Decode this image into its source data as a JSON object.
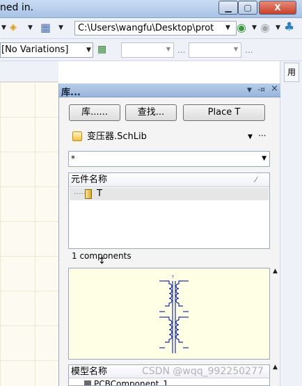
{
  "window": {
    "title_fragment": "ned in.",
    "buttons": {
      "minimize": "▁",
      "maximize": "▢",
      "close": "X"
    }
  },
  "toolbar": {
    "path": "C:\\Users\\wangfu\\Desktop\\prot",
    "variation": "[No Variations]",
    "dots": "..."
  },
  "side_panel_tab": "用",
  "library_panel": {
    "title": "库...",
    "header_buttons": [
      "▼",
      "-¤",
      "×"
    ],
    "buttons": {
      "libraries": "库......",
      "search": "查找...",
      "place": "Place T"
    },
    "current_library": "变压器.SchLib",
    "filter": "*",
    "component_column": "元件名称",
    "components": [
      "T"
    ],
    "component_count": "1 components",
    "model_column": "模型名称",
    "models": [
      "PCBComponent_1"
    ]
  },
  "icons": [
    "nav-arrow-icon",
    "grid-icon",
    "go-back-icon",
    "go-forward-icon",
    "home-icon",
    "library-icon",
    "component-icon",
    "pin-icon",
    "close-icon",
    "resize-icon"
  ],
  "watermark": "CSDN @wqq_992250277"
}
